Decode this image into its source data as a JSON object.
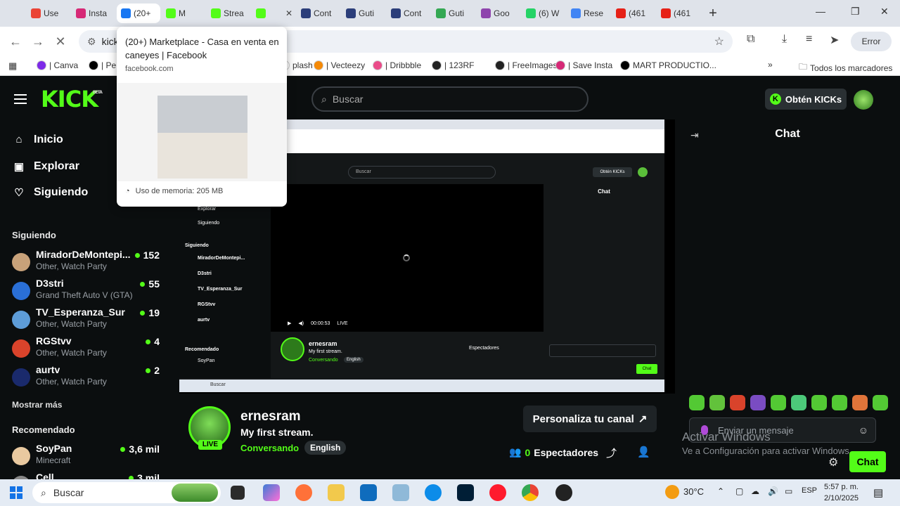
{
  "browser": {
    "tabs": [
      {
        "label": "Use",
        "color": "#ea4335"
      },
      {
        "label": "Insta",
        "color": "#d62976"
      },
      {
        "label": "(20+",
        "color": "#1877f2"
      },
      {
        "label": "M",
        "color": "#53fc18"
      },
      {
        "label": "Strea",
        "color": "#53fc18"
      },
      {
        "label": "",
        "color": "#53fc18"
      },
      {
        "label": "Cont",
        "color": "#2b3e7a"
      },
      {
        "label": "Guti",
        "color": "#2b3e7a"
      },
      {
        "label": "Cont",
        "color": "#2b3e7a"
      },
      {
        "label": "Guti",
        "color": "#34a853"
      },
      {
        "label": "Goo",
        "color": "#8e44ad"
      },
      {
        "label": "(6) W",
        "color": "#25d366"
      },
      {
        "label": "Rese",
        "color": "#4285f4"
      },
      {
        "label": "(461",
        "color": "#e62117"
      },
      {
        "label": "(461",
        "color": "#e62117"
      }
    ],
    "address": "kick",
    "error_label": "Error",
    "bookmarks": [
      {
        "label": "| Canva",
        "color": "#7d2ae8"
      },
      {
        "label": "| Pe",
        "color": "#000000"
      },
      {
        "label": "plash",
        "color": "#ffffff"
      },
      {
        "label": "| Vecteezy",
        "color": "#f58a07"
      },
      {
        "label": "| Dribbble",
        "color": "#ea4c89"
      },
      {
        "label": "| 123RF",
        "color": "#222222"
      },
      {
        "label": "| FreeImages",
        "color": "#222222"
      },
      {
        "label": "| Save Insta",
        "color": "#d62976"
      },
      {
        "label": "MART PRODUCTIO...",
        "color": "#000000"
      }
    ],
    "all_bookmarks": "Todos los marcadores"
  },
  "tab_preview": {
    "title": "(20+) Marketplace - Casa en venta en caneyes | Facebook",
    "url": "facebook.com",
    "memory": "Uso de memoria: 205 MB"
  },
  "kick": {
    "logo": "KICK",
    "beta": "BETA",
    "search_placeholder": "Buscar",
    "get_kicks": "Obtén KICKs",
    "nav": {
      "home": "Inicio",
      "explore": "Explorar",
      "following": "Siguiendo"
    },
    "following_title": "Siguiendo",
    "channels": [
      {
        "name": "MiradorDeMontepi...",
        "category": "Other, Watch Party",
        "viewers": "152",
        "color": "#c8a27a"
      },
      {
        "name": "D3stri",
        "category": "Grand Theft Auto V (GTA)",
        "viewers": "55",
        "color": "#2a6fd6"
      },
      {
        "name": "TV_Esperanza_Sur",
        "category": "Other, Watch Party",
        "viewers": "19",
        "color": "#5d9cd8"
      },
      {
        "name": "RGStvv",
        "category": "Other, Watch Party",
        "viewers": "4",
        "color": "#d9432b"
      },
      {
        "name": "aurtv",
        "category": "Other, Watch Party",
        "viewers": "2",
        "color": "#1a2a6c"
      }
    ],
    "show_more": "Mostrar más",
    "recommended_title": "Recomendado",
    "recommended": [
      {
        "name": "SoyPan",
        "category": "Minecraft",
        "viewers": "3,6 mil",
        "color": "#e9c9a0"
      },
      {
        "name": "Cell",
        "category": "",
        "viewers": "3 mil",
        "color": "#888888"
      }
    ],
    "streamer": {
      "name": "ernesram",
      "title": "My first stream.",
      "category": "Conversando",
      "language": "English",
      "live": "LIVE",
      "viewers": "0",
      "viewers_label": "Espectadores"
    },
    "customize_label": "Personaliza tu canal",
    "chat": {
      "title": "Chat",
      "placeholder": "Enviar un mensaje",
      "send_label": "Chat"
    }
  },
  "nested": {
    "search": "Buscar",
    "get_kicks": "Obtén KICKs",
    "chat": "Chat",
    "nav": [
      "Explorar",
      "Siguiendo"
    ],
    "following": "Siguiendo",
    "channels": [
      "MiradorDeMontepi...",
      "D3stri",
      "TV_Esperanza_Sur",
      "RGStvv",
      "aurtv"
    ],
    "recommended": "Recomendado",
    "rec_name": "SoyPan",
    "time": "00:00:53",
    "live": "LIVE",
    "streamer": "ernesram",
    "title": "My first stream.",
    "category": "Conversando",
    "lang": "English",
    "viewers": "Espectadores",
    "chat_btn": "Chat",
    "taskbar_search": "Buscar"
  },
  "windows": {
    "activate_title": "Activar Windows",
    "activate_sub": "Ve a Configuración para activar Windows.",
    "taskbar_search": "Buscar",
    "temp": "30°C",
    "lang": "ESP",
    "time": "5:57 p. m.",
    "date": "2/10/2025"
  }
}
